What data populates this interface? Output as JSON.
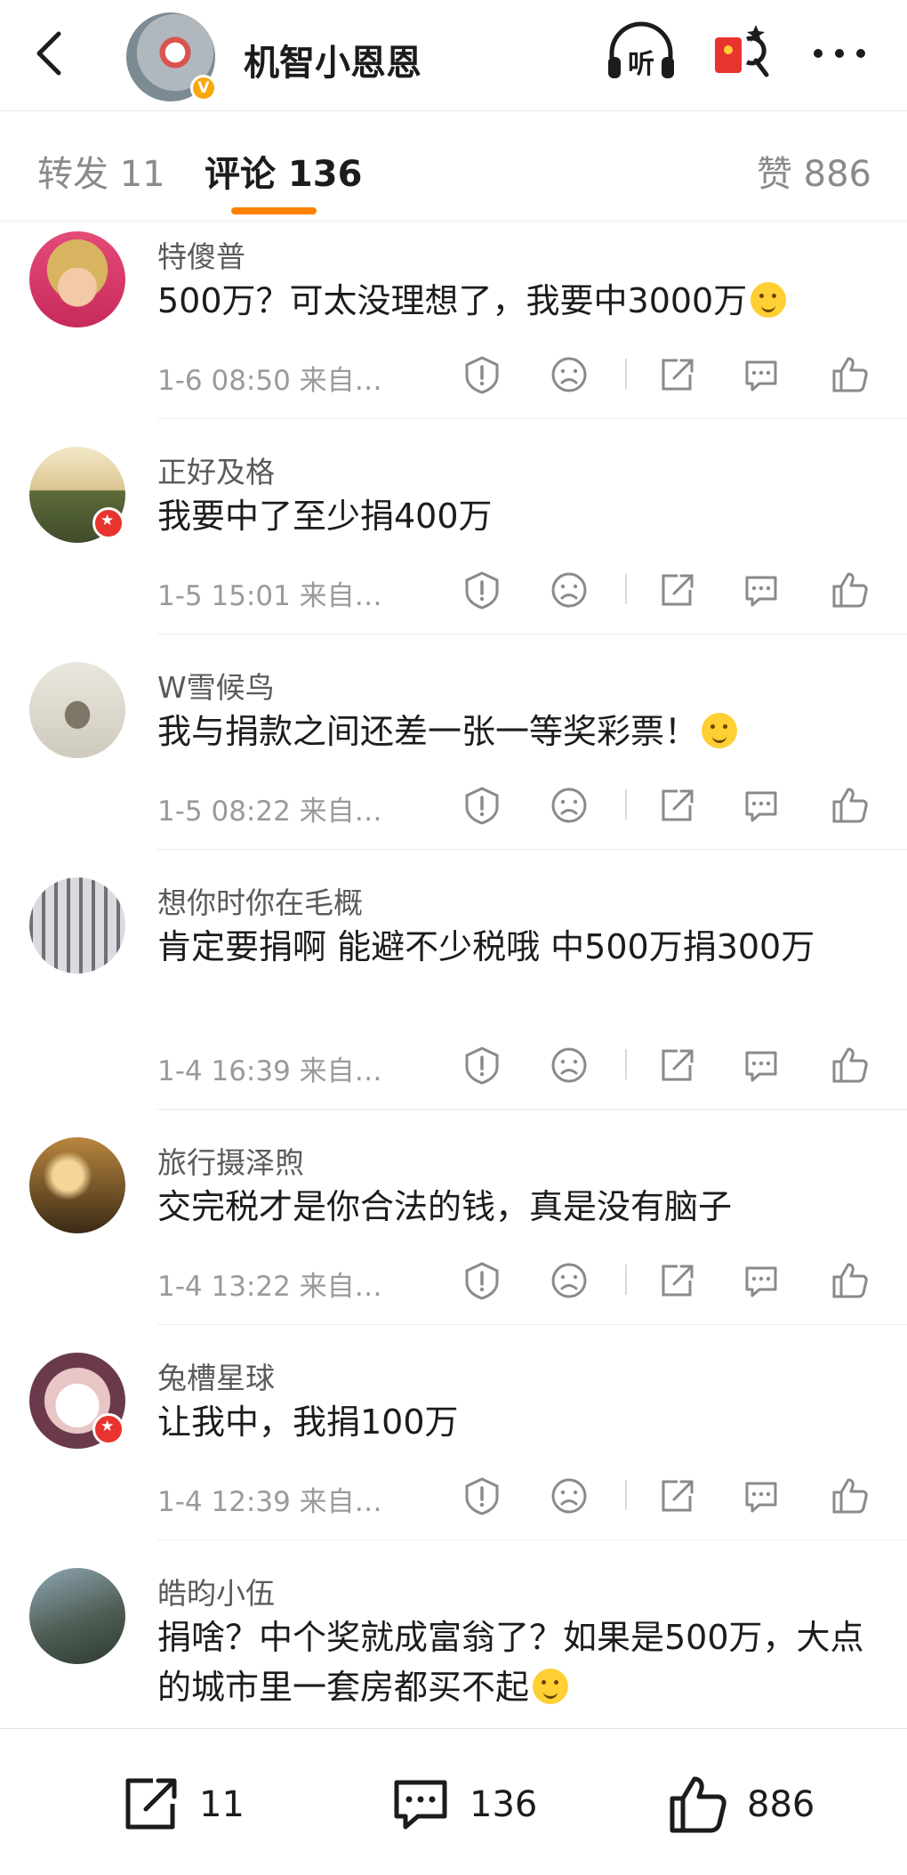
{
  "header": {
    "title": "机智小恩恩",
    "verified_badge": "V",
    "back_icon": "chevron-left-icon",
    "listen_label": "听",
    "redpack_icon": "red-envelope-icon",
    "more_icon": "more-horizontal-icon"
  },
  "tabs": {
    "repost": "转发 11",
    "comments": "评论 136",
    "likes": "赞 886",
    "active": "comments",
    "accent_color": "#ff8200"
  },
  "comments": [
    {
      "name": "特傻普",
      "text": "500万？可太没理想了，我要中3000万",
      "emoji": "smirk-emoji",
      "meta": "1-6 08:50  来自…",
      "badge": false
    },
    {
      "name": "正好及格",
      "text": "我要中了至少捐400万",
      "emoji": "",
      "meta": "1-5 15:01  来自…",
      "badge": true
    },
    {
      "name": "W雪候鸟",
      "text": "我与捐款之间还差一张一等奖彩票！",
      "emoji": "crying-emoji",
      "meta": "1-5 08:22  来自…",
      "badge": false
    },
    {
      "name": "想你时你在毛概",
      "text": "肯定要捐啊  能避不少税哦  中500万捐300万",
      "emoji": "",
      "meta": "1-4 16:39  来自…",
      "badge": false
    },
    {
      "name": "旅行摄泽煦",
      "text": "交完税才是你合法的钱，真是没有脑子",
      "emoji": "",
      "meta": "1-4 13:22  来自…",
      "badge": false
    },
    {
      "name": "兔槽星球",
      "text": "让我中，我捐100万",
      "emoji": "",
      "meta": "1-4 12:39  来自…",
      "badge": true
    },
    {
      "name": "皓昀小伍",
      "text": "捐啥？中个奖就成富翁了？如果是500万，大点的城市里一套房都买不起",
      "emoji": "laugh-cry-emoji",
      "meta": "",
      "badge": false
    }
  ],
  "comment_actions": [
    "report-icon",
    "dislike-icon",
    "share-icon",
    "reply-icon",
    "like-icon"
  ],
  "bottom_bar": {
    "repost_count": "11",
    "comment_count": "136",
    "like_count": "886"
  }
}
